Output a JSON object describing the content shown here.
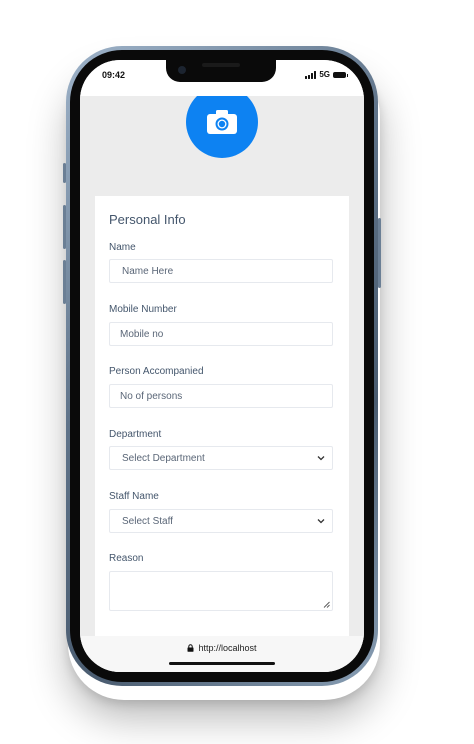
{
  "status_bar": {
    "time": "09:42",
    "network": "5G"
  },
  "header": {
    "avatar_icon": "camera-icon",
    "accent_color": "#0d82f2"
  },
  "form": {
    "title": "Personal Info",
    "fields": {
      "name": {
        "label": "Name",
        "placeholder": "Name Here"
      },
      "mobile": {
        "label": "Mobile Number",
        "placeholder": "Mobile no"
      },
      "accompanied": {
        "label": "Person Accompanied",
        "placeholder": "No of persons"
      },
      "department": {
        "label": "Department",
        "selected": "Select Department"
      },
      "staff": {
        "label": "Staff Name",
        "selected": "Select Staff"
      },
      "reason": {
        "label": "Reason"
      }
    }
  },
  "browser": {
    "url": "http://localhost",
    "lock_icon": "lock-icon"
  }
}
